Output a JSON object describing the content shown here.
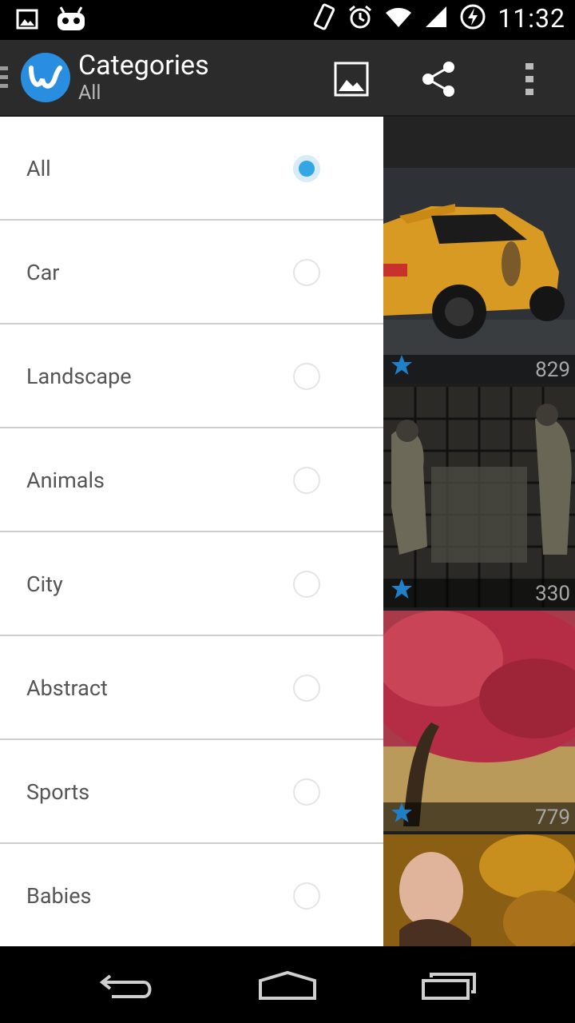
{
  "status_bar": {
    "time": "11:32",
    "icons": [
      "image-notification-icon",
      "android-robot-icon",
      "vibrate-icon",
      "alarm-icon",
      "wifi-icon",
      "signal-icon",
      "battery-charging-icon"
    ]
  },
  "action_bar": {
    "title": "Categories",
    "subtitle": "All",
    "actions": [
      "wallpaper-icon",
      "share-icon",
      "overflow-menu-icon"
    ]
  },
  "drawer": {
    "items": [
      {
        "label": "All",
        "selected": true
      },
      {
        "label": "Car",
        "selected": false
      },
      {
        "label": "Landscape",
        "selected": false
      },
      {
        "label": "Animals",
        "selected": false
      },
      {
        "label": "City",
        "selected": false
      },
      {
        "label": "Abstract",
        "selected": false
      },
      {
        "label": "Sports",
        "selected": false
      },
      {
        "label": "Babies",
        "selected": false
      }
    ]
  },
  "tiles": [
    {
      "name": "yellow-sports-car",
      "count": "829"
    },
    {
      "name": "soldiers-scene",
      "count": "330"
    },
    {
      "name": "red-tree",
      "count": "779"
    },
    {
      "name": "baby-in-leaves",
      "count": ""
    }
  ],
  "colors": {
    "accent": "#33a6e4",
    "action_bar": "#2b2b2b",
    "logo": "#2a8ee0",
    "star": "#1f7fc8"
  },
  "nav_bar": {
    "buttons": [
      "back-icon",
      "home-icon",
      "recent-apps-icon"
    ]
  }
}
